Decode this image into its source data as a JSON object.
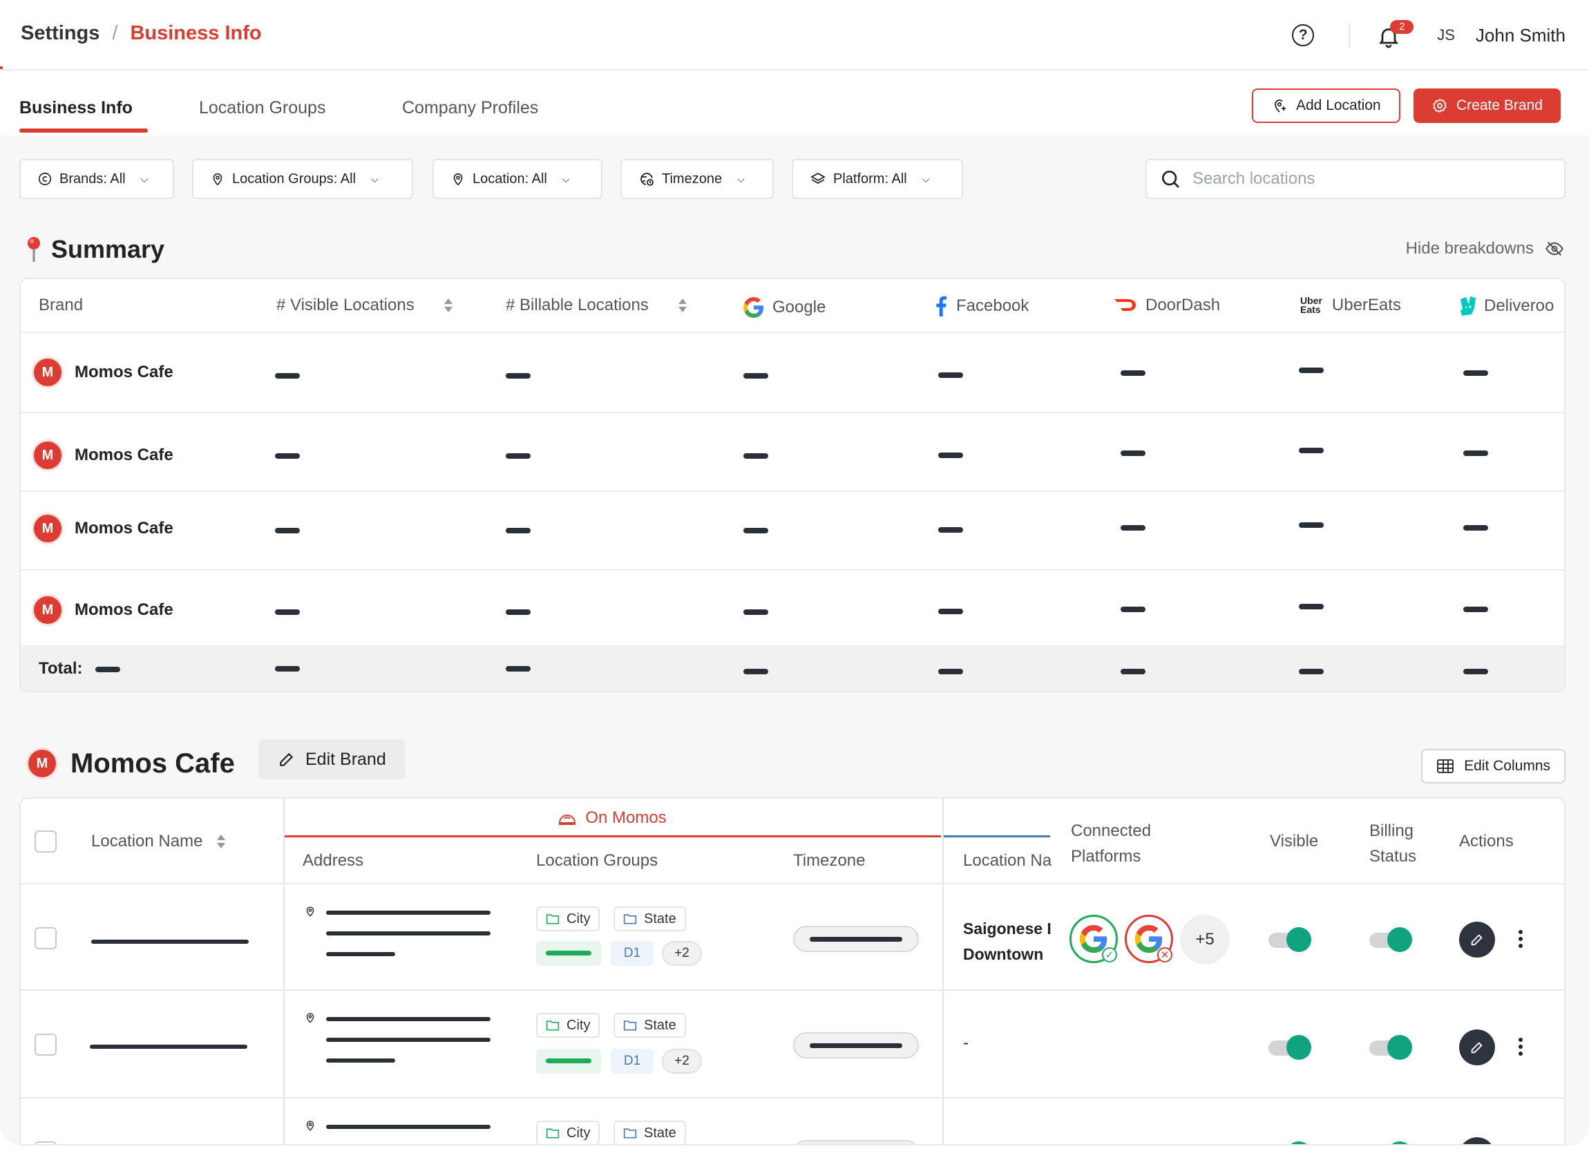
{
  "breadcrumb": {
    "parent": "Settings",
    "separator": "/",
    "current": "Business Info"
  },
  "header": {
    "help_glyph": "?",
    "notifications_count": "2",
    "user_initials": "JS",
    "user_name": "John Smith"
  },
  "tabs": [
    {
      "label": "Business Info",
      "active": true
    },
    {
      "label": "Location Groups",
      "active": false
    },
    {
      "label": "Company Profiles",
      "active": false
    }
  ],
  "actions": {
    "add_location": "Add Location",
    "create_brand": "Create Brand"
  },
  "filters": [
    {
      "label": "Brands:  All",
      "icon": "copyright-icon"
    },
    {
      "label": "Location Groups: All",
      "icon": "location-pin-icon"
    },
    {
      "label": "Location: All",
      "icon": "location-pin-icon"
    },
    {
      "label": "Timezone",
      "icon": "clock-globe-icon"
    },
    {
      "label": "Platform: All",
      "icon": "layers-icon"
    }
  ],
  "search": {
    "placeholder": "Search locations"
  },
  "summary": {
    "title": "Summary",
    "hide_breakdowns": "Hide breakdowns",
    "columns": [
      "Brand",
      "# Visible Locations",
      "# Billable Locations",
      "Google",
      "Facebook",
      "DoorDash",
      "UberEats",
      "Deliveroo"
    ],
    "uber_logo_line1": "Uber",
    "uber_logo_line2": "Eats",
    "rows": [
      {
        "avatar": "M",
        "brand": "Momos Cafe"
      },
      {
        "avatar": "M",
        "brand": "Momos Cafe"
      },
      {
        "avatar": "M",
        "brand": "Momos Cafe"
      },
      {
        "avatar": "M",
        "brand": "Momos Cafe"
      }
    ],
    "total_label": "Total:"
  },
  "brand_section": {
    "avatar": "M",
    "name": "Momos Cafe",
    "edit_brand": "Edit Brand",
    "edit_columns": "Edit Columns",
    "on_momos": "On Momos",
    "columns": {
      "location_name": "Location Name",
      "address": "Address",
      "location_groups": "Location Groups",
      "timezone": "Timezone",
      "location_name_ext": "Location Na",
      "connected_platforms_1": "Connected",
      "connected_platforms_2": "Platforms",
      "visible": "Visible",
      "billing_1": "Billing",
      "billing_2": "Status",
      "actions": "Actions"
    },
    "rows": [
      {
        "chip_city": "City",
        "chip_state": "State",
        "chip_d1": "D1",
        "chip_more": "+2",
        "location_name_1": "Saigonese I",
        "location_name_2": "Downtown",
        "platforms_more": "+5"
      },
      {
        "chip_city": "City",
        "chip_state": "State",
        "chip_d1": "D1",
        "chip_more": "+2",
        "location_name_1": "-"
      },
      {
        "chip_city": "City",
        "chip_state": "State"
      }
    ]
  },
  "colors": {
    "accent": "#dc3d32",
    "toggle_on": "#10a37f",
    "google_blue": "#4285f4",
    "facebook_blue": "#1877f2",
    "doordash_red": "#ff3008",
    "deliveroo_teal": "#00ccbc"
  }
}
